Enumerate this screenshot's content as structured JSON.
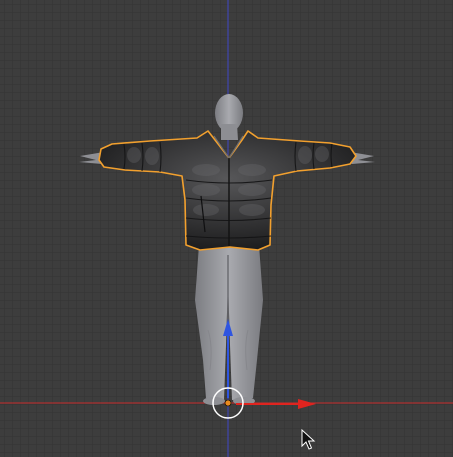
{
  "viewport": {
    "view_type": "3d-viewport",
    "background": "#3d3d3d",
    "grid_color": "#323232",
    "axis_x_color": "#c92c2c",
    "axis_z_color": "#3f46c8",
    "selection_outline_color": "#f2a02e",
    "origin_color": "#e88a1e",
    "gizmo_x_color": "#e0241f",
    "gizmo_z_color": "#2f55e0"
  },
  "objects": [
    {
      "name": "body",
      "color": "#9a9ba0",
      "selected": false
    },
    {
      "name": "jacket",
      "color": "#2b2b2c",
      "selected": true
    }
  ],
  "cursor": {
    "icon": "arrow-pointer"
  }
}
